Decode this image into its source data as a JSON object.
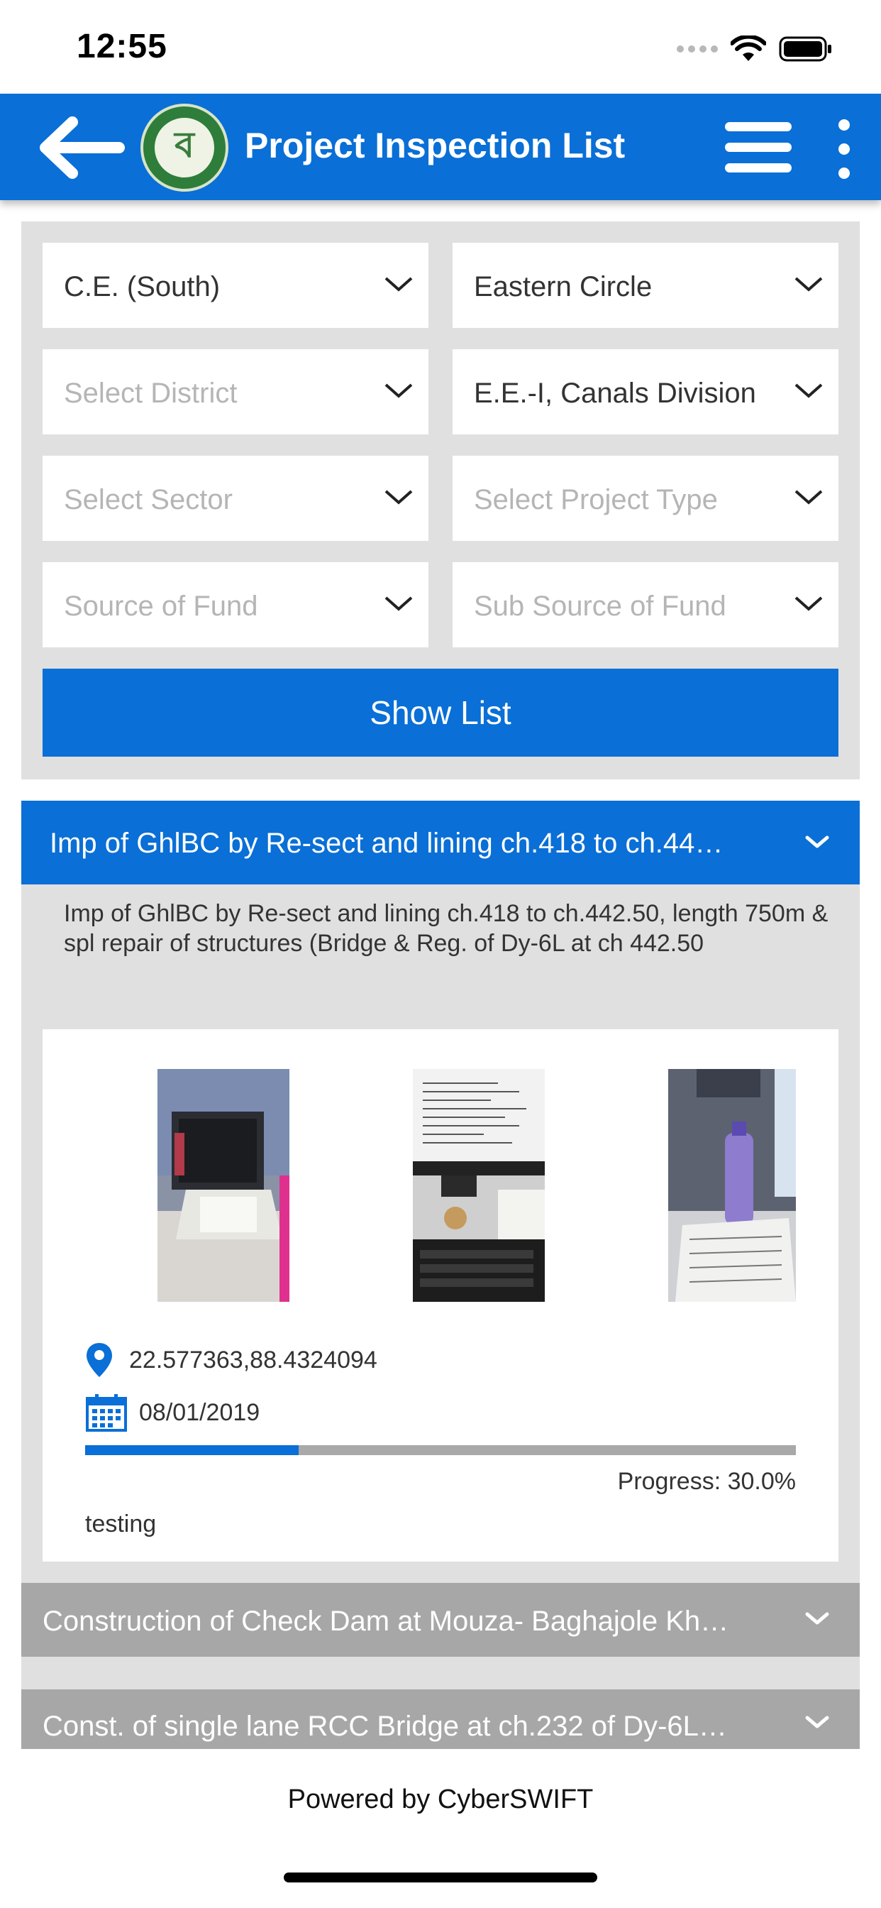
{
  "status_bar": {
    "time": "12:55"
  },
  "header": {
    "title": "Project Inspection List",
    "logo_text": "ব"
  },
  "filters": {
    "chief_engineer": "C.E. (South)",
    "circle": "Eastern Circle",
    "district_placeholder": "Select District",
    "division": "E.E.-I, Canals Division",
    "sector_placeholder": "Select Sector",
    "project_type_placeholder": "Select Project Type",
    "fund_placeholder": "Source of Fund",
    "sub_fund_placeholder": "Sub Source of Fund",
    "show_button": "Show List"
  },
  "projects": [
    {
      "title": "Imp of GhlBC by Re-sect and lining ch.418 to ch.44…",
      "description": "Imp of GhlBC by Re-sect and lining ch.418 to ch.442.50, length 750m & spl repair of structures (Bridge & Reg. of Dy-6L at ch 442.50",
      "coordinates": "22.577363,88.4324094",
      "date": "08/01/2019",
      "progress_value": 30.0,
      "progress_label": "Progress: 30.0%",
      "remarks": "testing"
    },
    {
      "title": "Construction of Check Dam at Mouza- Baghajole Kh…"
    },
    {
      "title": "Const. of single lane RCC Bridge at ch.232 of Dy-6L…"
    }
  ],
  "footer": {
    "text": "Powered by CyberSWIFT"
  },
  "colors": {
    "primary": "#0a6fd6",
    "panel": "#e0e0e0",
    "collapsed_header": "#a7a7a7"
  }
}
